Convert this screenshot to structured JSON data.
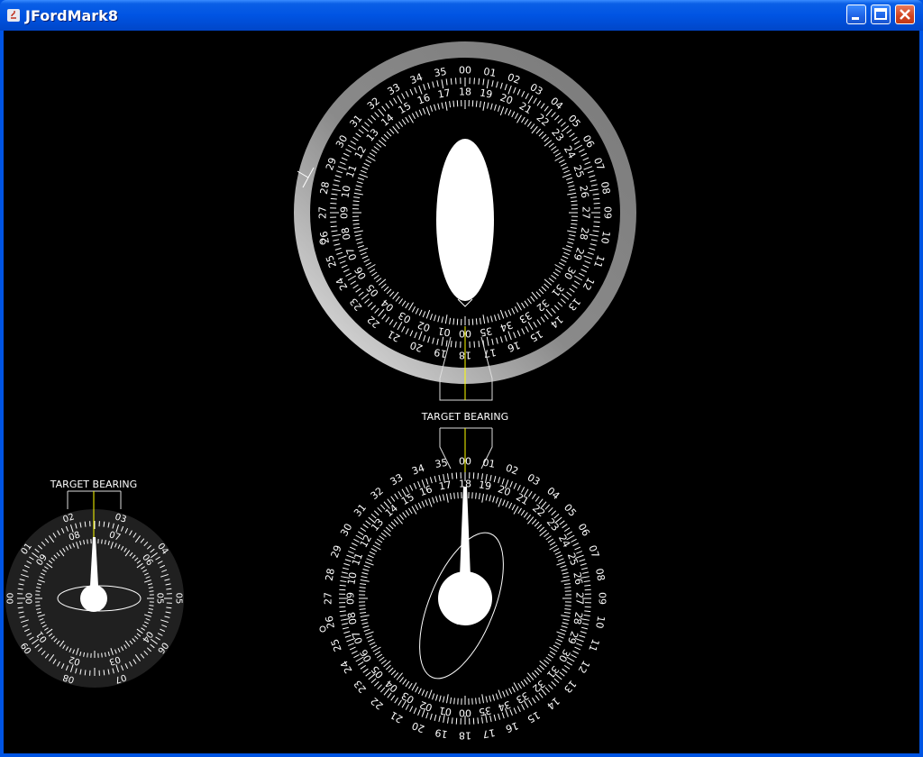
{
  "window": {
    "title": "JFordMark8"
  },
  "title_buttons": [
    "minimize-button",
    "maximize-button",
    "close-button"
  ],
  "colors": {
    "titlebar": "#0054e3",
    "background": "#000000",
    "dial_text": "#ffffff",
    "bearing_line": "#ffff00",
    "bezel": "#808080",
    "small_dial_face": "#202020"
  },
  "top_dial": {
    "label": "TARGET BEARING",
    "outer_ring": [
      "00",
      "01",
      "02",
      "03",
      "04",
      "05",
      "06",
      "07",
      "08",
      "09",
      "10",
      "11",
      "12",
      "13",
      "14",
      "15",
      "16",
      "17",
      "18",
      "19",
      "20",
      "21",
      "22",
      "23",
      "24",
      "25",
      "26",
      "27",
      "28",
      "29",
      "30",
      "31",
      "32",
      "33",
      "34",
      "35"
    ],
    "inner_ring": [
      "00",
      "01",
      "02",
      "03",
      "04",
      "05",
      "06",
      "07",
      "08",
      "09",
      "10",
      "11",
      "12",
      "13",
      "14",
      "15",
      "16",
      "17",
      "18",
      "19",
      "20",
      "21",
      "22",
      "23",
      "24",
      "25",
      "26",
      "27",
      "28",
      "29",
      "30",
      "31",
      "32",
      "33",
      "34",
      "35"
    ],
    "bearing_marker": "28"
  },
  "bottom_dial": {
    "outer_ring": [
      "00",
      "01",
      "02",
      "03",
      "04",
      "05",
      "06",
      "07",
      "08",
      "09",
      "10",
      "11",
      "12",
      "13",
      "14",
      "15",
      "16",
      "17",
      "18",
      "19",
      "20",
      "21",
      "22",
      "23",
      "24",
      "25",
      "26",
      "27",
      "28",
      "29",
      "30",
      "31",
      "32",
      "33",
      "34",
      "35"
    ],
    "inner_ring": [
      "00",
      "01",
      "02",
      "03",
      "04",
      "05",
      "06",
      "07",
      "08",
      "09",
      "10",
      "11",
      "12",
      "13",
      "14",
      "15",
      "16",
      "17",
      "18",
      "19",
      "20",
      "21",
      "22",
      "23",
      "24",
      "25",
      "26",
      "27",
      "28",
      "29",
      "30",
      "31",
      "32",
      "33",
      "34",
      "35"
    ],
    "bearing_marker": "10"
  },
  "small_dial": {
    "label": "TARGET BEARING",
    "outer_ring": [
      "00",
      "01",
      "02",
      "03",
      "04",
      "05",
      "06",
      "07",
      "08",
      "09"
    ],
    "inner_ring": [
      "00",
      "01",
      "02",
      "03",
      "04",
      "05",
      "06",
      "07",
      "08",
      "09"
    ]
  }
}
